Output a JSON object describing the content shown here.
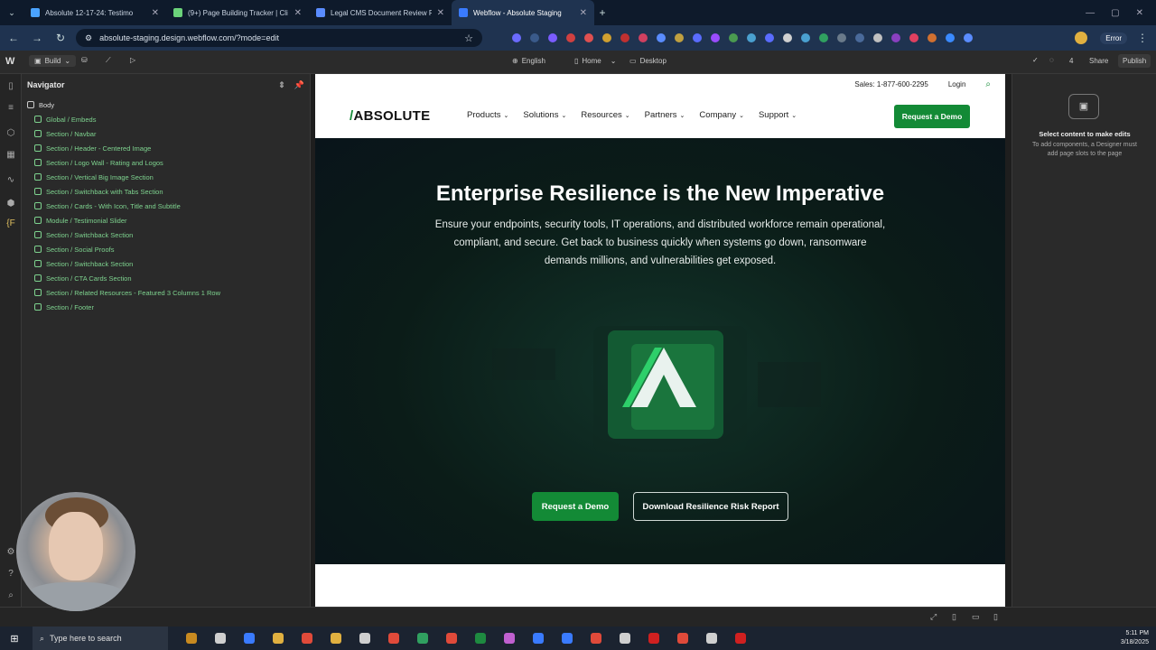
{
  "browser": {
    "tabs": [
      {
        "title": "Absolute 12-17-24: Testimo",
        "color": "#4aa3ff",
        "active": false
      },
      {
        "title": "(9+) Page Building Tracker | Cli",
        "color": "#6bd37a",
        "active": false
      },
      {
        "title": "Legal CMS Document Review F",
        "color": "#5a8cff",
        "active": false
      },
      {
        "title": "Webflow - Absolute Staging",
        "color": "#3a7bff",
        "active": true
      }
    ],
    "new_tab": "+",
    "url": "absolute-staging.design.webflow.com/?mode=edit",
    "error_label": "Error"
  },
  "webflow": {
    "build_label": "Build",
    "language": "English",
    "page": "Home",
    "breakpoint": "Desktop",
    "comments_count": "4",
    "share_label": "Share",
    "publish_label": "Publish"
  },
  "navigator": {
    "title": "Navigator",
    "root": "Body",
    "items": [
      "Global / Embeds",
      "Section / Navbar",
      "Section / Header - Centered Image",
      "Section / Logo Wall - Rating and Logos",
      "Section / Vertical Big Image Section",
      "Section / Switchback with Tabs Section",
      "Section / Cards - With Icon, Title and Subtitle",
      "Module / Testimonial Slider",
      "Section / Switchback Section",
      "Section / Social Proofs",
      "Section / Switchback Section",
      "Section / CTA Cards Section",
      "Section / Related Resources - Featured 3 Columns 1 Row",
      "Section / Footer"
    ]
  },
  "site": {
    "sales": "Sales: 1-877-600-2295",
    "login": "Login",
    "logo": "ABSOLUTE",
    "menu": [
      "Products",
      "Solutions",
      "Resources",
      "Partners",
      "Company",
      "Support"
    ],
    "header_cta": "Request a Demo",
    "hero_title": "Enterprise Resilience is the New Imperative",
    "hero_subtitle": "Ensure your endpoints, security tools, IT operations, and distributed workforce remain operational, compliant, and secure. Get back to business quickly when systems go down, ransomware demands millions, and vulnerabilities get exposed.",
    "hero_primary": "Request a Demo",
    "hero_secondary": "Download Resilience Risk Report",
    "brand_green": "#138a36"
  },
  "right_panel": {
    "title": "Select content to make edits",
    "body": "To add components, a Designer must add page slots to the page"
  },
  "taskbar": {
    "search_placeholder": "Type here to search",
    "time": "5:11 PM",
    "date": "3/18/2025"
  }
}
